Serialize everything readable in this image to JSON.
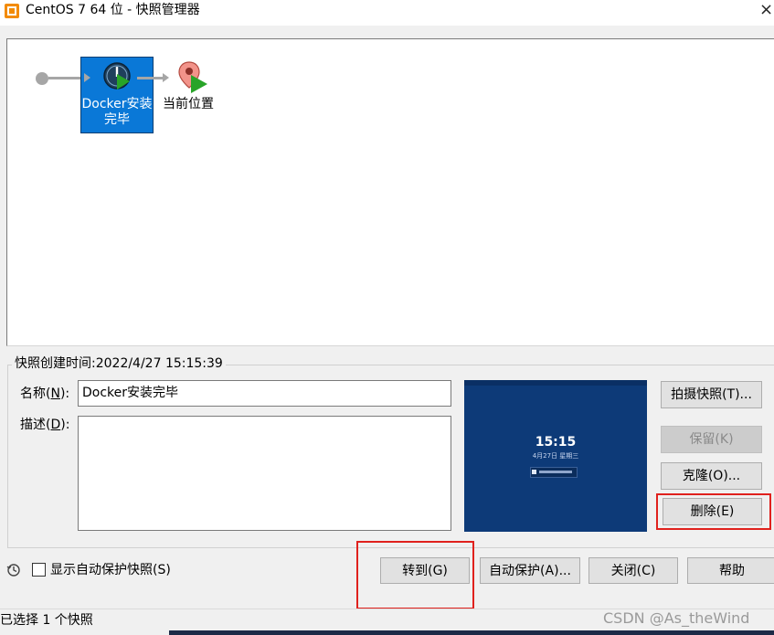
{
  "window": {
    "title": "CentOS 7 64 位 - 快照管理器",
    "close_glyph": "×",
    "app_icon": "vmware-icon"
  },
  "tree": {
    "snapshot_label": "Docker安装完毕",
    "current_label": "当前位置",
    "snapshot_icon": "clock-play-icon",
    "current_icon": "location-pin-icon"
  },
  "details": {
    "created_label": "快照创建时间:2022/4/27 15:15:39",
    "name_label": "名称(",
    "name_key": "N",
    "name_suffix": "):",
    "name_value": "Docker安装完毕",
    "desc_label": "描述(",
    "desc_key": "D",
    "desc_suffix": "):",
    "desc_value": ""
  },
  "thumbnail": {
    "time": "15:15",
    "date": "4月27日 星期三"
  },
  "side_buttons": {
    "take_snapshot": "拍摄快照(T)...",
    "keep": "保留(K)",
    "clone": "克隆(O)...",
    "delete": "删除(E)"
  },
  "bottom": {
    "show_autoprotect": "显示自动保护快照(S)",
    "goto": "转到(G)",
    "autoprotect": "自动保护(A)...",
    "close": "关闭(C)",
    "help": "帮助"
  },
  "status": {
    "text": "已选择 1 个快照",
    "watermark": "CSDN @As_theWind"
  },
  "colors": {
    "selection": "#0a78d7",
    "highlight": "#e0211d",
    "thumbnail_bg": "#0d3a78"
  }
}
